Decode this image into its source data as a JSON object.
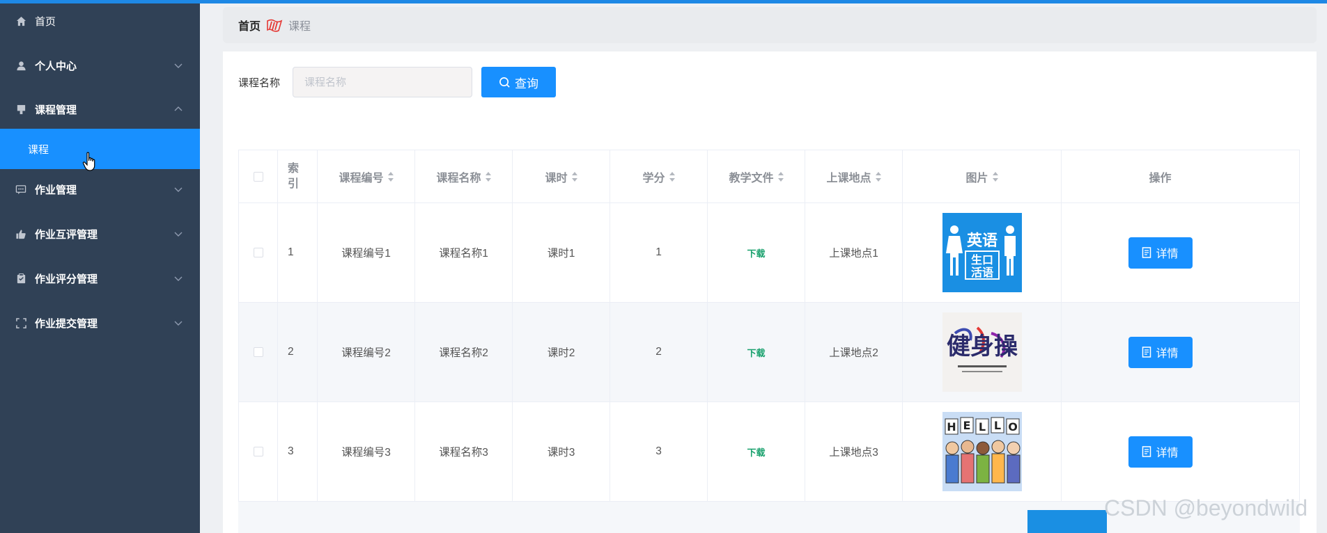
{
  "sidebar": {
    "items": [
      {
        "label": "首页",
        "icon": "home-icon"
      },
      {
        "label": "个人中心",
        "icon": "user-icon"
      },
      {
        "label": "课程管理",
        "icon": "course-icon",
        "expanded": true
      },
      {
        "label": "课程",
        "active": true
      },
      {
        "label": "作业管理",
        "icon": "comment-icon"
      },
      {
        "label": "作业互评管理",
        "icon": "thumb-icon"
      },
      {
        "label": "作业评分管理",
        "icon": "clipboard-icon"
      },
      {
        "label": "作业提交管理",
        "icon": "fullscreen-icon"
      }
    ]
  },
  "breadcrumb": {
    "home": "首页",
    "current": "课程"
  },
  "search": {
    "label": "课程名称",
    "placeholder": "课程名称",
    "button": "查询"
  },
  "table": {
    "headers": {
      "index": "索\n引",
      "code": "课程编号",
      "name": "课程名称",
      "hours": "课时",
      "credit": "学分",
      "file": "教学文件",
      "place": "上课地点",
      "image": "图片",
      "action": "操作"
    },
    "rows": [
      {
        "index": "1",
        "code": "课程编号1",
        "name": "课程名称1",
        "hours": "课时1",
        "credit": "1",
        "file": "下载",
        "place": "上课地点1",
        "action": "详情"
      },
      {
        "index": "2",
        "code": "课程编号2",
        "name": "课程名称2",
        "hours": "课时2",
        "credit": "2",
        "file": "下载",
        "place": "上课地点2",
        "action": "详情"
      },
      {
        "index": "3",
        "code": "课程编号3",
        "name": "课程名称3",
        "hours": "课时3",
        "credit": "3",
        "file": "下载",
        "place": "上课地点3",
        "action": "详情"
      }
    ],
    "images": {
      "english": {
        "line1": "英语",
        "line2": "生口",
        "line3": "活语"
      },
      "fitness": {
        "title": "健身操"
      },
      "hello": {
        "letters": [
          "H",
          "E",
          "L",
          "L",
          "O"
        ]
      }
    }
  },
  "watermark": "CSDN @beyondwild",
  "colors": {
    "sidebar": "#304156",
    "accent": "#1890ff",
    "download": "#19a16d"
  }
}
